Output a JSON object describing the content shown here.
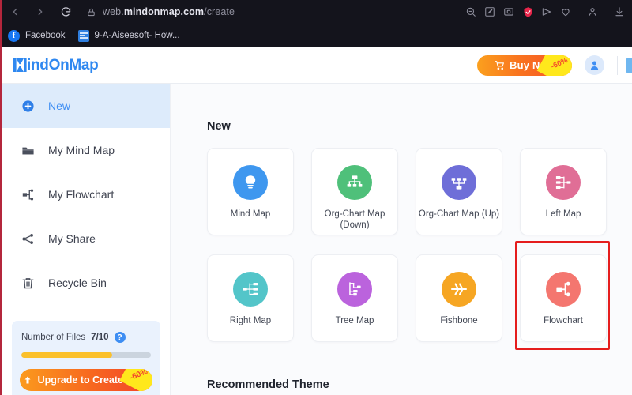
{
  "browser": {
    "nav": {
      "back_icon": "chevron-left-icon",
      "forward_icon": "chevron-right-icon",
      "reload_icon": "reload-icon"
    },
    "omnibox": {
      "lock_icon": "lock-icon",
      "url_prefix": "web.",
      "url_domain": "mindonmap.com",
      "url_path": "/create"
    },
    "toolbar_icons": [
      {
        "name": "zoom-search-icon"
      },
      {
        "name": "edit-markup-icon"
      },
      {
        "name": "screenshot-icon"
      },
      {
        "name": "shield-check-icon"
      },
      {
        "name": "send-share-icon"
      },
      {
        "name": "heart-icon"
      },
      {
        "name": "profile-icon"
      },
      {
        "name": "download-icon"
      }
    ],
    "bookmarks": [
      {
        "label": "Facebook",
        "icon": "facebook-icon"
      },
      {
        "label": "9-A-Aiseesoft- How...",
        "icon": "document-icon"
      }
    ]
  },
  "header": {
    "logo_text": "indOnMap",
    "buy_now_label": "Buy Now",
    "buy_now_discount": "-60%",
    "cart_icon": "shopping-cart-icon",
    "avatar_icon": "user-avatar-icon"
  },
  "sidebar": {
    "items": [
      {
        "label": "New",
        "icon": "plus-circle-icon",
        "active": true
      },
      {
        "label": "My Mind Map",
        "icon": "folder-icon",
        "active": false
      },
      {
        "label": "My Flowchart",
        "icon": "flowchart-icon",
        "active": false
      },
      {
        "label": "My Share",
        "icon": "share-nodes-icon",
        "active": false
      },
      {
        "label": "Recycle Bin",
        "icon": "trash-icon",
        "active": false
      }
    ],
    "files": {
      "label": "Number of Files",
      "count": "7/10",
      "progress_percent": 70,
      "help_icon": "question-mark-icon"
    },
    "upgrade": {
      "label": "Upgrade to Create More",
      "discount": "-60%",
      "icon": "up-arrow-icon"
    }
  },
  "main": {
    "new_section_title": "New",
    "recommended_section_title": "Recommended Theme",
    "cards": [
      {
        "label": "Mind Map",
        "icon": "mind-map-icon",
        "color": "#3e97ef",
        "selected": false
      },
      {
        "label": "Org-Chart Map (Down)",
        "icon": "org-chart-down-icon",
        "color": "#4fc07a",
        "selected": false
      },
      {
        "label": "Org-Chart Map (Up)",
        "icon": "org-chart-up-icon",
        "color": "#6e6ed8",
        "selected": false
      },
      {
        "label": "Left Map",
        "icon": "left-map-icon",
        "color": "#e06e96",
        "selected": false
      },
      {
        "label": "Right Map",
        "icon": "right-map-icon",
        "color": "#53c5c9",
        "selected": false
      },
      {
        "label": "Tree Map",
        "icon": "tree-map-icon",
        "color": "#bb63dd",
        "selected": false
      },
      {
        "label": "Fishbone",
        "icon": "fishbone-icon",
        "color": "#f6a623",
        "selected": false
      },
      {
        "label": "Flowchart",
        "icon": "flowchart-card-icon",
        "color": "#f4766f",
        "selected": true
      }
    ]
  },
  "annotation": {
    "highlight_color": "#e51d1d",
    "target": "Flowchart"
  }
}
